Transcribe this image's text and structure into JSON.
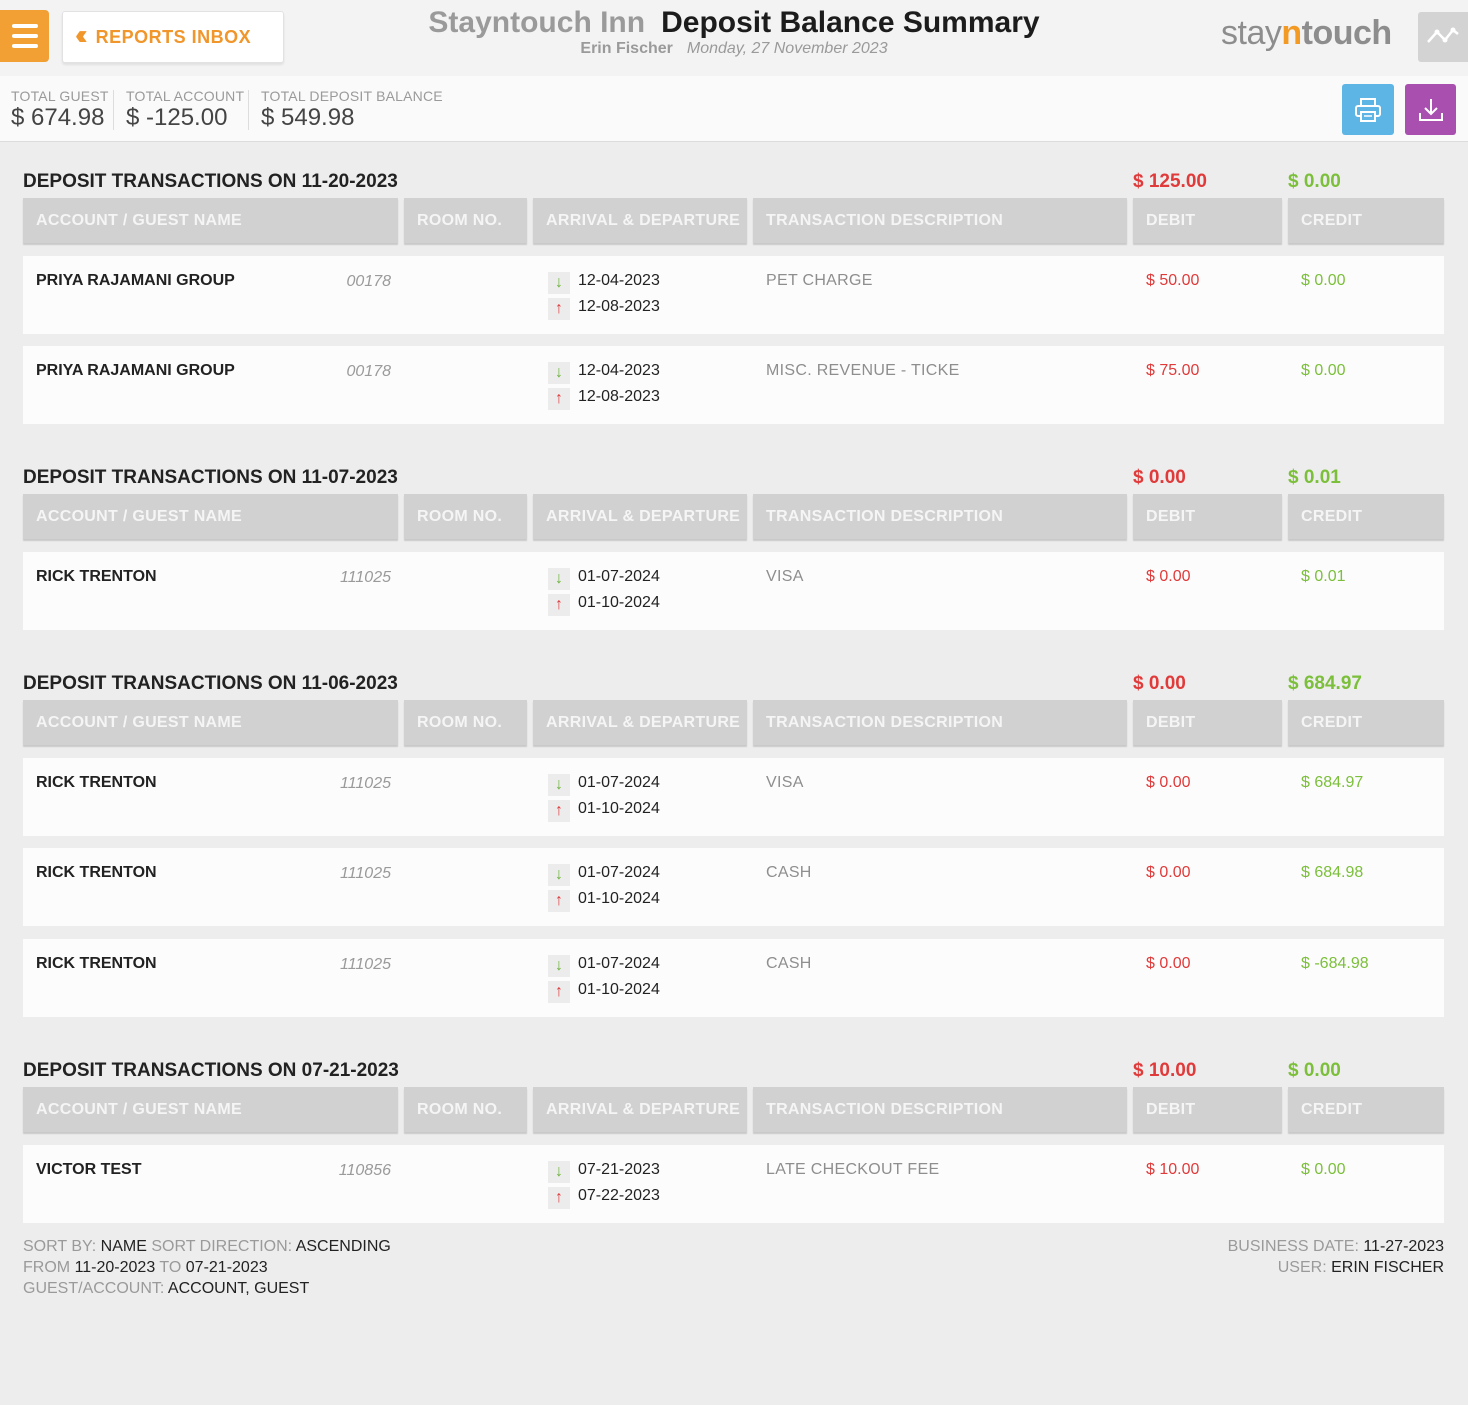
{
  "header": {
    "inbox_label": "REPORTS INBOX",
    "hotel_name": "Stayntouch Inn",
    "report_title": "Deposit Balance Summary",
    "user_name": "Erin Fischer",
    "report_date": "Monday, 27 November 2023",
    "logo_pre": "stay",
    "logo_n": "n",
    "logo_post": "touch"
  },
  "totals": [
    {
      "label": "TOTAL GUEST",
      "value": "$ 674.98"
    },
    {
      "label": "TOTAL ACCOUNT",
      "value": "$ -125.00"
    },
    {
      "label": "TOTAL DEPOSIT BALANCE",
      "value": "$ 549.98"
    }
  ],
  "columns": {
    "name": "ACCOUNT / GUEST NAME",
    "room": "ROOM NO.",
    "dates": "ARRIVAL & DEPARTURE",
    "desc": "TRANSACTION DESCRIPTION",
    "debit": "DEBIT",
    "credit": "CREDIT"
  },
  "sections": [
    {
      "title": "DEPOSIT TRANSACTIONS ON 11-20-2023",
      "debit_total": "$ 125.00",
      "credit_total": "$ 0.00",
      "rows": [
        {
          "name": "PRIYA RAJAMANI GROUP",
          "room": "00178",
          "arrival": "12-04-2023",
          "departure": "12-08-2023",
          "desc": "PET CHARGE",
          "debit": "$ 50.00",
          "credit": "$ 0.00"
        },
        {
          "name": "PRIYA RAJAMANI GROUP",
          "room": "00178",
          "arrival": "12-04-2023",
          "departure": "12-08-2023",
          "desc": "MISC. REVENUE - TICKE",
          "debit": "$ 75.00",
          "credit": "$ 0.00"
        }
      ]
    },
    {
      "title": "DEPOSIT TRANSACTIONS ON 11-07-2023",
      "debit_total": "$ 0.00",
      "credit_total": "$ 0.01",
      "rows": [
        {
          "name": "RICK TRENTON",
          "room": "111025",
          "arrival": "01-07-2024",
          "departure": "01-10-2024",
          "desc": "VISA",
          "debit": "$ 0.00",
          "credit": "$ 0.01"
        }
      ]
    },
    {
      "title": "DEPOSIT TRANSACTIONS ON 11-06-2023",
      "debit_total": "$ 0.00",
      "credit_total": "$ 684.97",
      "rows": [
        {
          "name": "RICK TRENTON",
          "room": "111025",
          "arrival": "01-07-2024",
          "departure": "01-10-2024",
          "desc": "VISA",
          "debit": "$ 0.00",
          "credit": "$ 684.97"
        },
        {
          "name": "RICK TRENTON",
          "room": "111025",
          "arrival": "01-07-2024",
          "departure": "01-10-2024",
          "desc": "CASH",
          "debit": "$ 0.00",
          "credit": "$ 684.98"
        },
        {
          "name": "RICK TRENTON",
          "room": "111025",
          "arrival": "01-07-2024",
          "departure": "01-10-2024",
          "desc": "CASH",
          "debit": "$ 0.00",
          "credit": "$ -684.98"
        }
      ]
    },
    {
      "title": "DEPOSIT TRANSACTIONS ON 07-21-2023",
      "debit_total": "$ 10.00",
      "credit_total": "$ 0.00",
      "rows": [
        {
          "name": "VICTOR TEST",
          "room": "110856",
          "arrival": "07-21-2023",
          "departure": "07-22-2023",
          "desc": "LATE CHECKOUT FEE",
          "debit": "$ 10.00",
          "credit": "$ 0.00"
        }
      ]
    }
  ],
  "footer": {
    "sort_by_label": "SORT BY:",
    "sort_by": "NAME",
    "sort_dir_label": "SORT DIRECTION:",
    "sort_dir": "ASCENDING",
    "from_label": "FROM",
    "from": "11-20-2023",
    "to_label": "TO",
    "to": "07-21-2023",
    "guest_account_label": "GUEST/ACCOUNT:",
    "guest_account": "ACCOUNT, GUEST",
    "business_date_label": "BUSINESS DATE:",
    "business_date": "11-27-2023",
    "user_label": "USER:",
    "user": "ERIN FISCHER"
  },
  "colors": {
    "accent_orange": "#f2a033",
    "debit_red": "#e03a3a",
    "credit_green": "#7bbf3a",
    "print_blue": "#5db5e6",
    "download_purple": "#a84fb0"
  }
}
